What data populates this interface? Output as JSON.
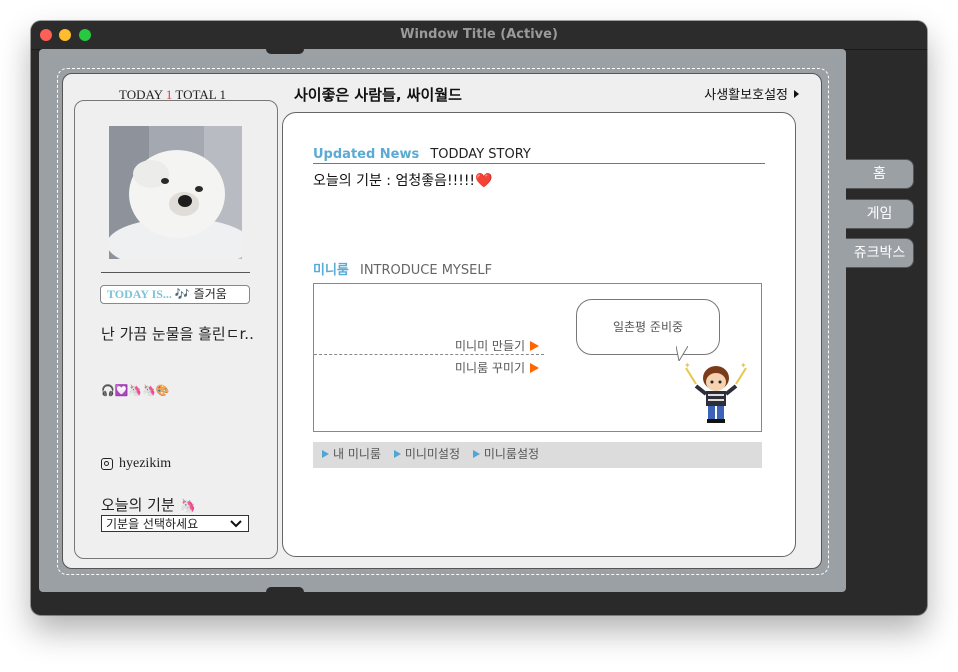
{
  "window": {
    "title": "Window Title (Active)"
  },
  "visitors": {
    "today_label": "TODAY",
    "today_count": "1",
    "total_label": "TOTAL",
    "total_count": "1"
  },
  "site": {
    "title": "사이좋은 사람들, 싸이월드",
    "privacy_link": "사생활보호설정"
  },
  "profile": {
    "today_is_label": "TODAY IS...",
    "today_is_value": "🎶 즐거움",
    "bio": "난 가끔 눈물을 흘린ㄷr..",
    "emoji_line": "🎧💟🦄🦄🎨",
    "instagram": "hyezikim",
    "mood_label": "오늘의 기분",
    "mood_emoji": "🦄",
    "mood_select_value": "기분을 선택하세요"
  },
  "news": {
    "section": "Updated News",
    "section_sub": "TODDAY STORY",
    "item": "오늘의 기분 : 엄청좋음!!!!!",
    "item_heart": "❤️"
  },
  "miniroom": {
    "section": "미니룸",
    "section_sub": "INTRODUCE MYSELF",
    "link_make": "미니미 만들기",
    "link_decorate": "미니룸 꾸미기",
    "speech": "일촌평 준비중",
    "bar_links": [
      "내 미니룸",
      "미니미설정",
      "미니룸설정"
    ]
  },
  "tabs": [
    "홈",
    "게임",
    "쥬크박스"
  ],
  "icons": {
    "instagram": "instagram-icon",
    "chevron": "chevron-down-icon",
    "privacy_arrow": "triangle-right-icon",
    "link_arrow": "orange-triangle-icon",
    "bar_arrow": "blue-triangle-icon"
  },
  "colors": {
    "accent": "#5aaad4",
    "today_count": "#e53935",
    "link_arrow": "#ff6600",
    "book": "#9ba0a5"
  }
}
